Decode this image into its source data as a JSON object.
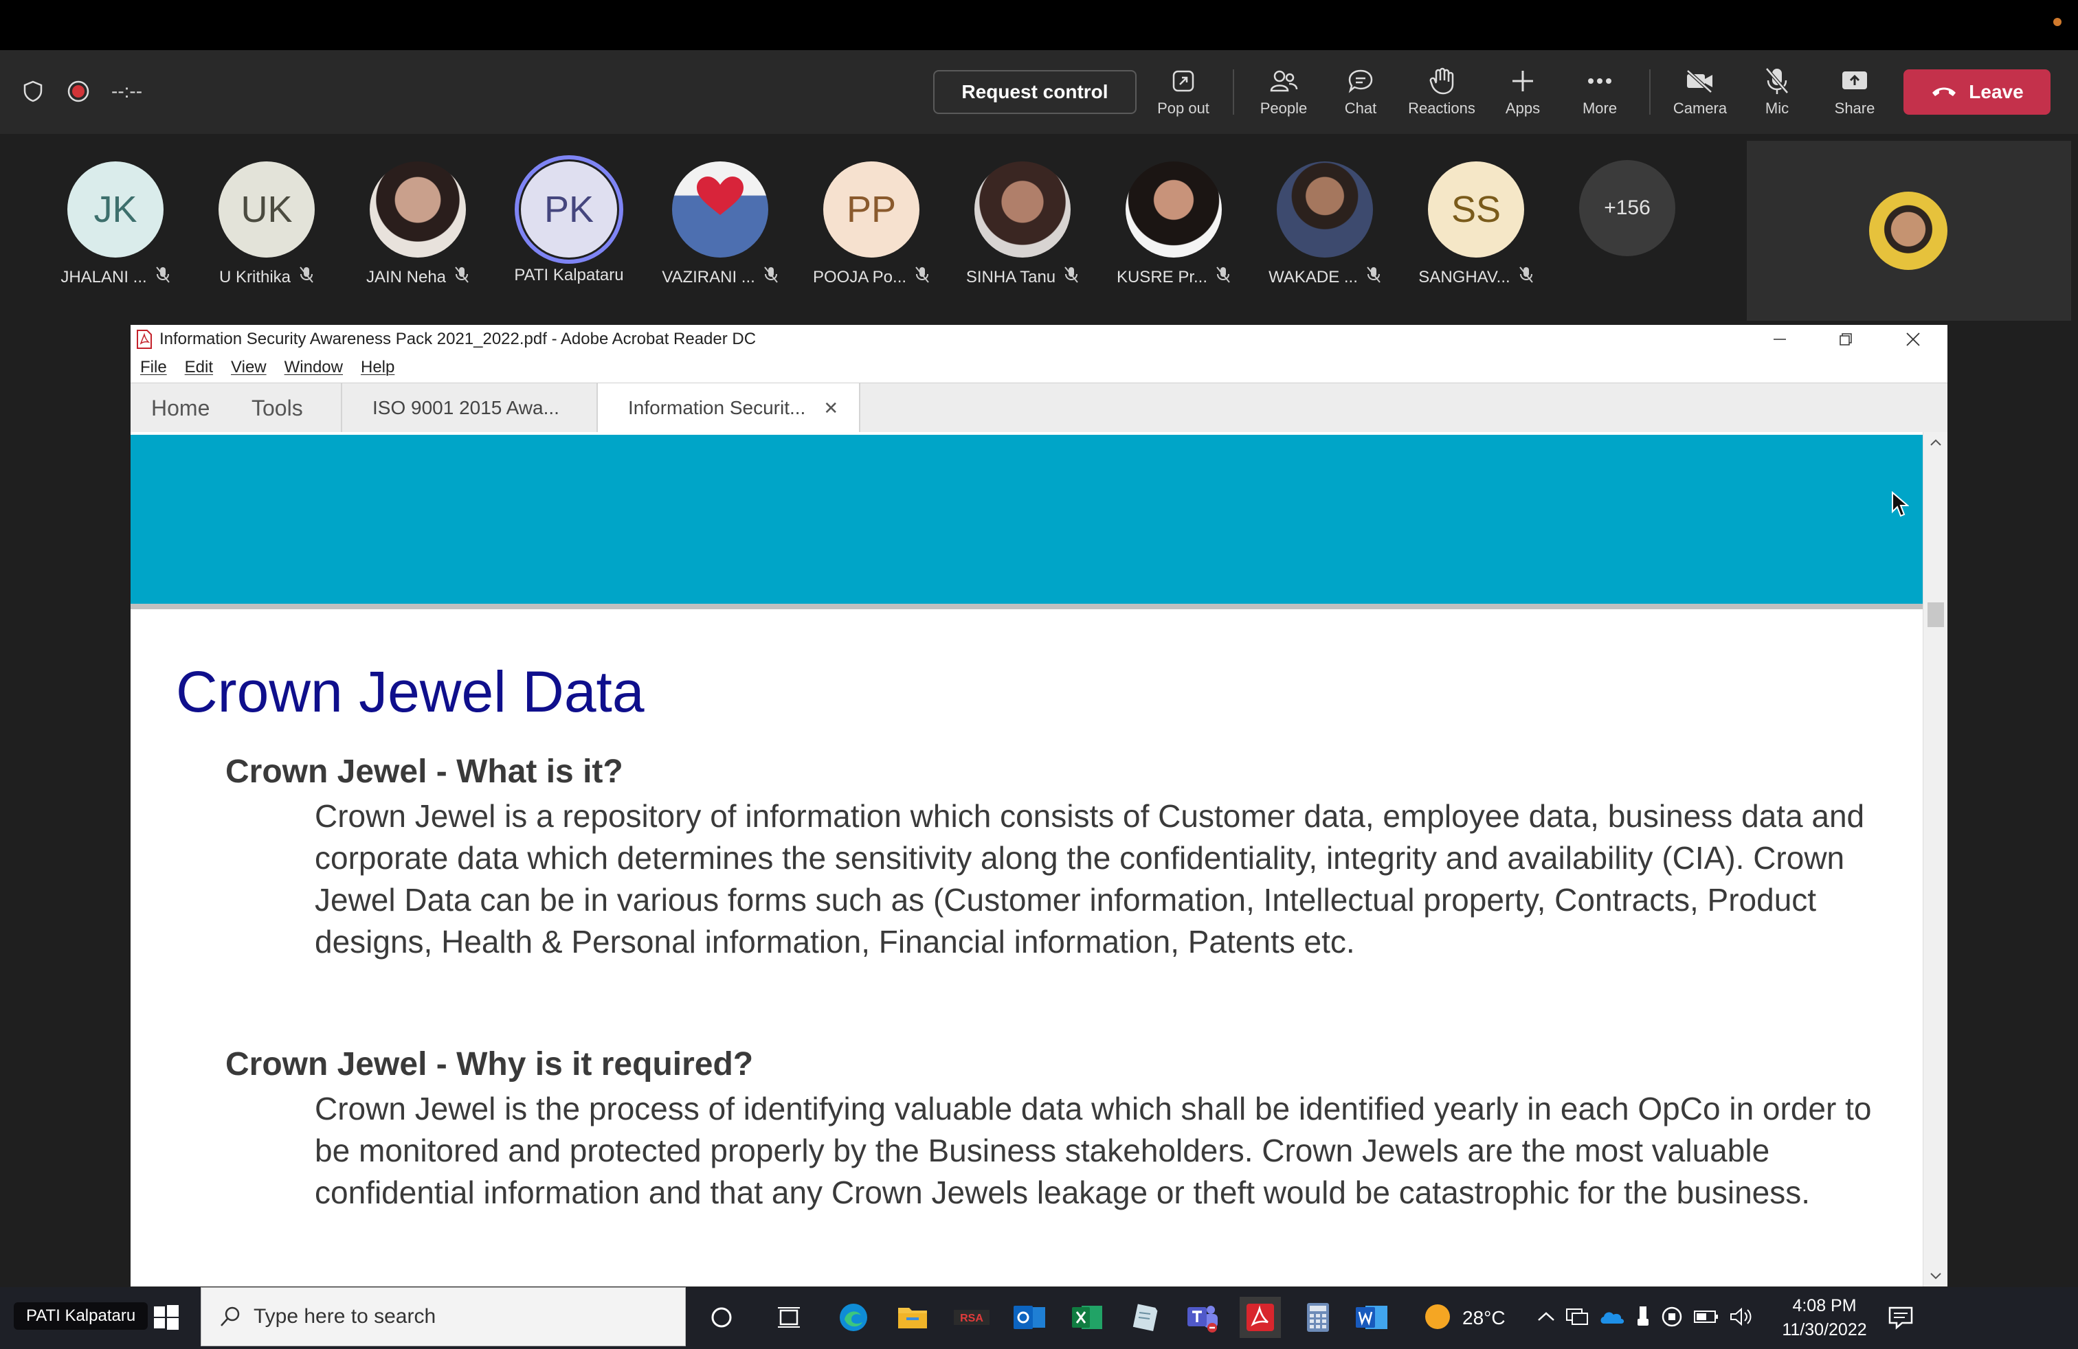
{
  "toolbar": {
    "timer": "--:--",
    "request_control": "Request control",
    "items": {
      "popout": "Pop out",
      "people": "People",
      "chat": "Chat",
      "reactions": "Reactions",
      "apps": "Apps",
      "more": "More",
      "camera": "Camera",
      "mic": "Mic",
      "share": "Share"
    },
    "leave": "Leave"
  },
  "participants": [
    {
      "initials": "JK",
      "name": "JHALANI ...",
      "bg": "#daeceb"
    },
    {
      "initials": "UK",
      "name": "U Krithika",
      "bg": "#e3e3d9"
    },
    {
      "initials": "",
      "name": "JAIN Neha",
      "bg": "#b48a78"
    },
    {
      "initials": "PK",
      "name": "PATI Kalpataru",
      "bg": "#dfdff0"
    },
    {
      "initials": "",
      "name": "VAZIRANI ...",
      "bg": "#4d6fb0"
    },
    {
      "initials": "PP",
      "name": "POOJA Po...",
      "bg": "#f6e1cf"
    },
    {
      "initials": "",
      "name": "SINHA Tanu",
      "bg": "#7a5a52"
    },
    {
      "initials": "",
      "name": "KUSRE Pr...",
      "bg": "#3a2e2a"
    },
    {
      "initials": "",
      "name": "WAKADE ...",
      "bg": "#56483e"
    },
    {
      "initials": "SS",
      "name": "SANGHAV...",
      "bg": "#f5e7c7"
    }
  ],
  "more_participants": "+156",
  "acrobat": {
    "title": "Information Security Awareness Pack 2021_2022.pdf - Adobe Acrobat Reader DC",
    "menu": [
      "File",
      "Edit",
      "View",
      "Window",
      "Help"
    ],
    "nav_home": "Home",
    "nav_tools": "Tools",
    "tab1": "ISO 9001 2015 Awa...",
    "tab2": "Information Securit...",
    "doc": {
      "title": "Crown Jewel Data",
      "h1": "Crown Jewel - What is it?",
      "p1": "Crown Jewel is a repository of information which consists of Customer data, employee data, business data and corporate data which determines the sensitivity along the confidentiality, integrity and availability (CIA). Crown Jewel Data can be in various forms such as (Customer information, Intellectual property, Contracts, Product designs, Health & Personal information, Financial information, Patents etc.",
      "h2": "Crown Jewel - Why is it required?",
      "p2": "Crown Jewel is the process of identifying valuable data which shall be identified yearly in each OpCo in order to be monitored and protected properly by the Business stakeholders. Crown Jewels are the most valuable confidential information and that any Crown Jewels leakage or theft would be catastrophic for the business."
    },
    "banner_color": "#00a5c8"
  },
  "taskbar": {
    "presenter": "PATI Kalpataru",
    "search_placeholder": "Type here to search",
    "weather": "28°C",
    "time": "4:08 PM",
    "date": "11/30/2022"
  }
}
